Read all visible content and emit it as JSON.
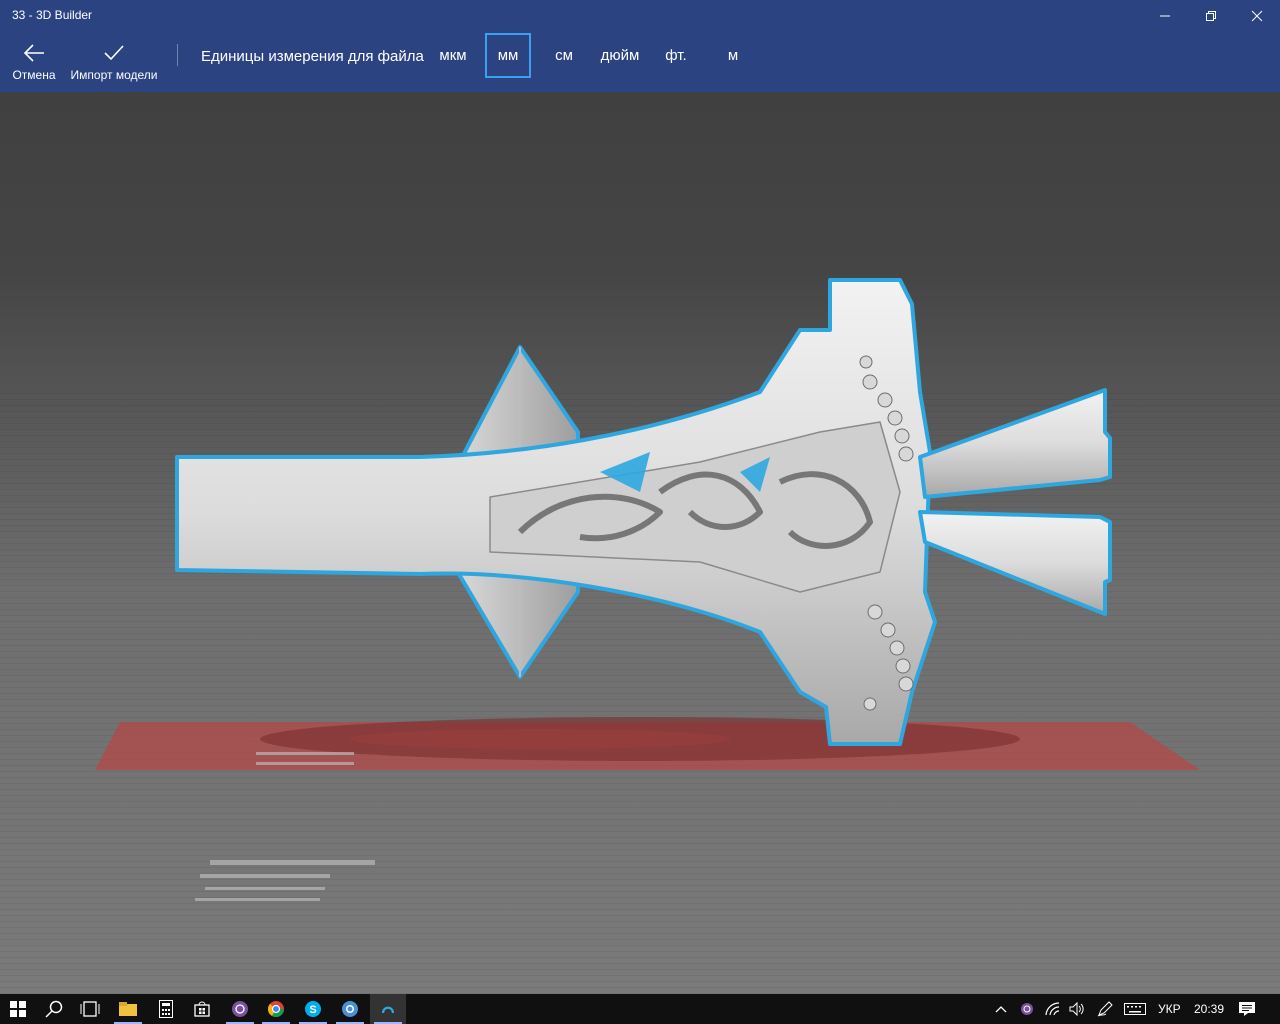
{
  "window": {
    "title": "33 - 3D Builder"
  },
  "toolbar": {
    "cancel_label": "Отмена",
    "import_label": "Импорт модели",
    "units_label": "Единицы измерения для файла",
    "units": [
      "мкм",
      "мм",
      "см",
      "дюйм",
      "фт.",
      "м"
    ],
    "selected_unit": "мм"
  },
  "colors": {
    "accent": "#2b4381",
    "selection": "#3aa0f0",
    "outline": "#2ea7e0",
    "plate": "#b44848"
  },
  "taskbar": {
    "icons": [
      "windows-start-icon",
      "search-icon",
      "task-view-icon",
      "file-explorer-icon",
      "calculator-icon",
      "store-icon",
      "viber-icon",
      "chrome-icon",
      "skype-icon",
      "chromium-icon",
      "3d-builder-icon"
    ],
    "language": "УКР",
    "time": "20:39"
  }
}
